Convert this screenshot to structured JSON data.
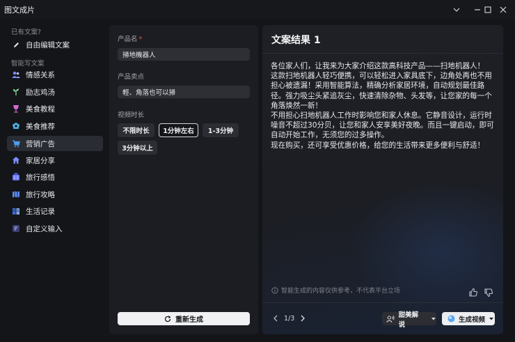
{
  "window": {
    "title": "图文成片"
  },
  "sidebar": {
    "section_existing": "已有文案?",
    "free_edit": "自由编辑文案",
    "section_smart": "智能写文案",
    "items": [
      {
        "label": "情感关系",
        "icon": "people-icon"
      },
      {
        "label": "励志鸡汤",
        "icon": "sprout-icon"
      },
      {
        "label": "美食教程",
        "icon": "cup-icon"
      },
      {
        "label": "美食推荐",
        "icon": "dish-icon"
      },
      {
        "label": "营销广告",
        "icon": "cart-icon"
      },
      {
        "label": "家居分享",
        "icon": "house-icon"
      },
      {
        "label": "旅行感悟",
        "icon": "suitcase-icon"
      },
      {
        "label": "旅行攻略",
        "icon": "map-icon"
      },
      {
        "label": "生活记录",
        "icon": "book-icon"
      },
      {
        "label": "自定义输入",
        "icon": "edit-box-icon"
      }
    ],
    "active_index": 4
  },
  "form": {
    "product_name_label": "产品名",
    "required_mark": "*",
    "product_name_value": "掃地機器人",
    "selling_point_label": "产品卖点",
    "selling_point_value": "輕、角落也可以掃",
    "duration_label": "视频时长",
    "duration_options": [
      "不限时长",
      "1分钟左右",
      "1-3分钟",
      "3分钟以上"
    ],
    "duration_selected": "1分钟左右",
    "regenerate_label": "重新生成"
  },
  "result": {
    "title": "文案结果 1",
    "text": "各位家人们，让我来为大家介绍这款高科技产品——扫地机器人！\n这款扫地机器人轻巧便携，可以轻松进入家具底下，边角处再也不用担心被遗漏！采用智能算法，精确分析家居环境，自动规划最佳路径。强力吸尘头紧追灰尘，快速清除杂物、头发等，让您家的每一个角落焕然一新！\n不用担心扫地机器人工作时影响您和家人休息。它静音设计，运行时噪音不超过30分贝，让您和家人安享美好夜晚。而且一键启动，即可自动开始工作，无须您的过多操作。\n现在购买，还可享受优惠价格，给您的生活带来更多便利与舒适！",
    "disclaimer": "智能生成的内容仅供参考，不代表平台立场",
    "pager": "1/3",
    "voice_button": "甜美解说",
    "video_button": "生成视频"
  },
  "colors": {
    "accent_required": "#e2564d",
    "video_icon": "#5aa7f0"
  }
}
